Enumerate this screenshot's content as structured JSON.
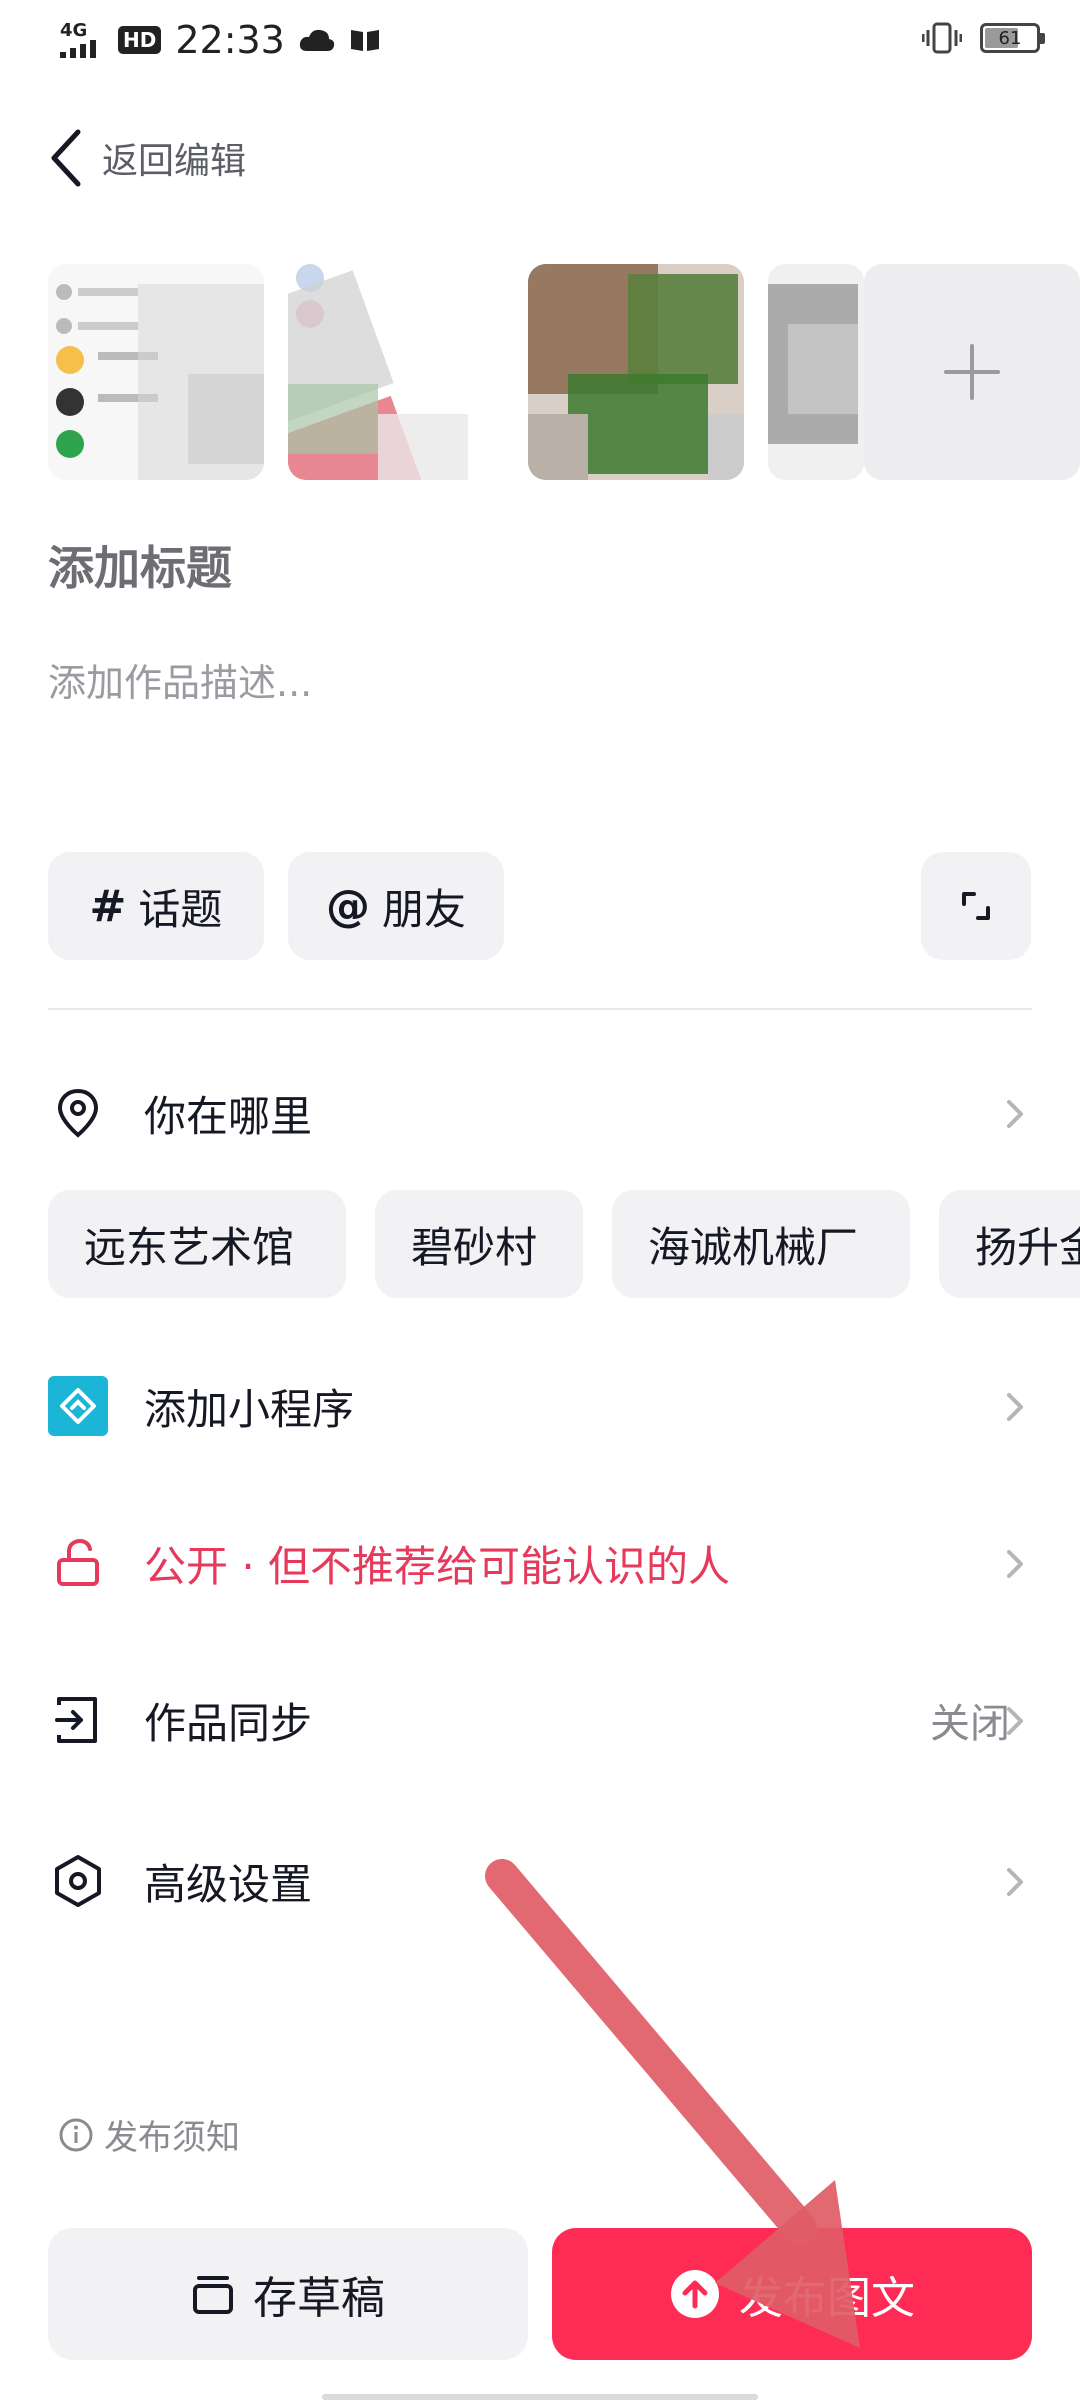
{
  "status_bar": {
    "network": "4G",
    "hd": "HD",
    "time": "22:33",
    "battery": "61",
    "battery_level": 0.61
  },
  "header": {
    "back_label": "返回编辑"
  },
  "editor": {
    "title_placeholder": "添加标题",
    "description_placeholder": "添加作品描述..."
  },
  "chips": {
    "topic_symbol": "#",
    "topic_label": "话题",
    "friend_symbol": "@",
    "friend_label": "朋友"
  },
  "location": {
    "label": "你在哪里",
    "suggestions": [
      "远东艺术馆",
      "碧砂村",
      "海诚机械厂",
      "扬升金"
    ]
  },
  "mini_program": {
    "label": "添加小程序"
  },
  "privacy": {
    "label": "公开 · 但不推荐给可能认识的人",
    "color": "#e6395b"
  },
  "sync": {
    "label": "作品同步",
    "value": "关闭"
  },
  "advanced": {
    "label": "高级设置"
  },
  "notice": {
    "label": "发布须知"
  },
  "actions": {
    "draft_label": "存草稿",
    "publish_label": "发布图文",
    "publish_color": "#fe2c55"
  }
}
